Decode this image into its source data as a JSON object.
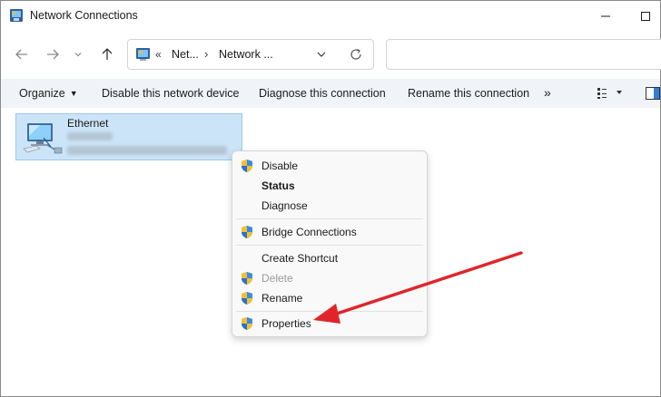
{
  "window": {
    "title": "Network Connections"
  },
  "address": {
    "chevron": "«",
    "crumb1": "Net...",
    "separator": "›",
    "crumb2": "Network ..."
  },
  "commands": {
    "organize": "Organize",
    "disable_device": "Disable this network device",
    "diagnose": "Diagnose this connection",
    "rename": "Rename this connection",
    "more": "»"
  },
  "connection": {
    "name": "Ethernet"
  },
  "context_menu": {
    "items": [
      {
        "label": "Disable",
        "shield": true,
        "bold": false,
        "disabled": false
      },
      {
        "label": "Status",
        "shield": false,
        "bold": true,
        "disabled": false
      },
      {
        "label": "Diagnose",
        "shield": false,
        "bold": false,
        "disabled": false
      },
      {
        "label": "Bridge Connections",
        "shield": true,
        "bold": false,
        "disabled": false
      },
      {
        "label": "Create Shortcut",
        "shield": false,
        "bold": false,
        "disabled": false
      },
      {
        "label": "Delete",
        "shield": true,
        "bold": false,
        "disabled": true
      },
      {
        "label": "Rename",
        "shield": true,
        "bold": false,
        "disabled": false
      },
      {
        "label": "Properties",
        "shield": true,
        "bold": false,
        "disabled": false
      }
    ]
  },
  "colors": {
    "selection": "#cce4f7",
    "command_bar": "#f0f4f9",
    "annotation_arrow": "#e0252a"
  }
}
